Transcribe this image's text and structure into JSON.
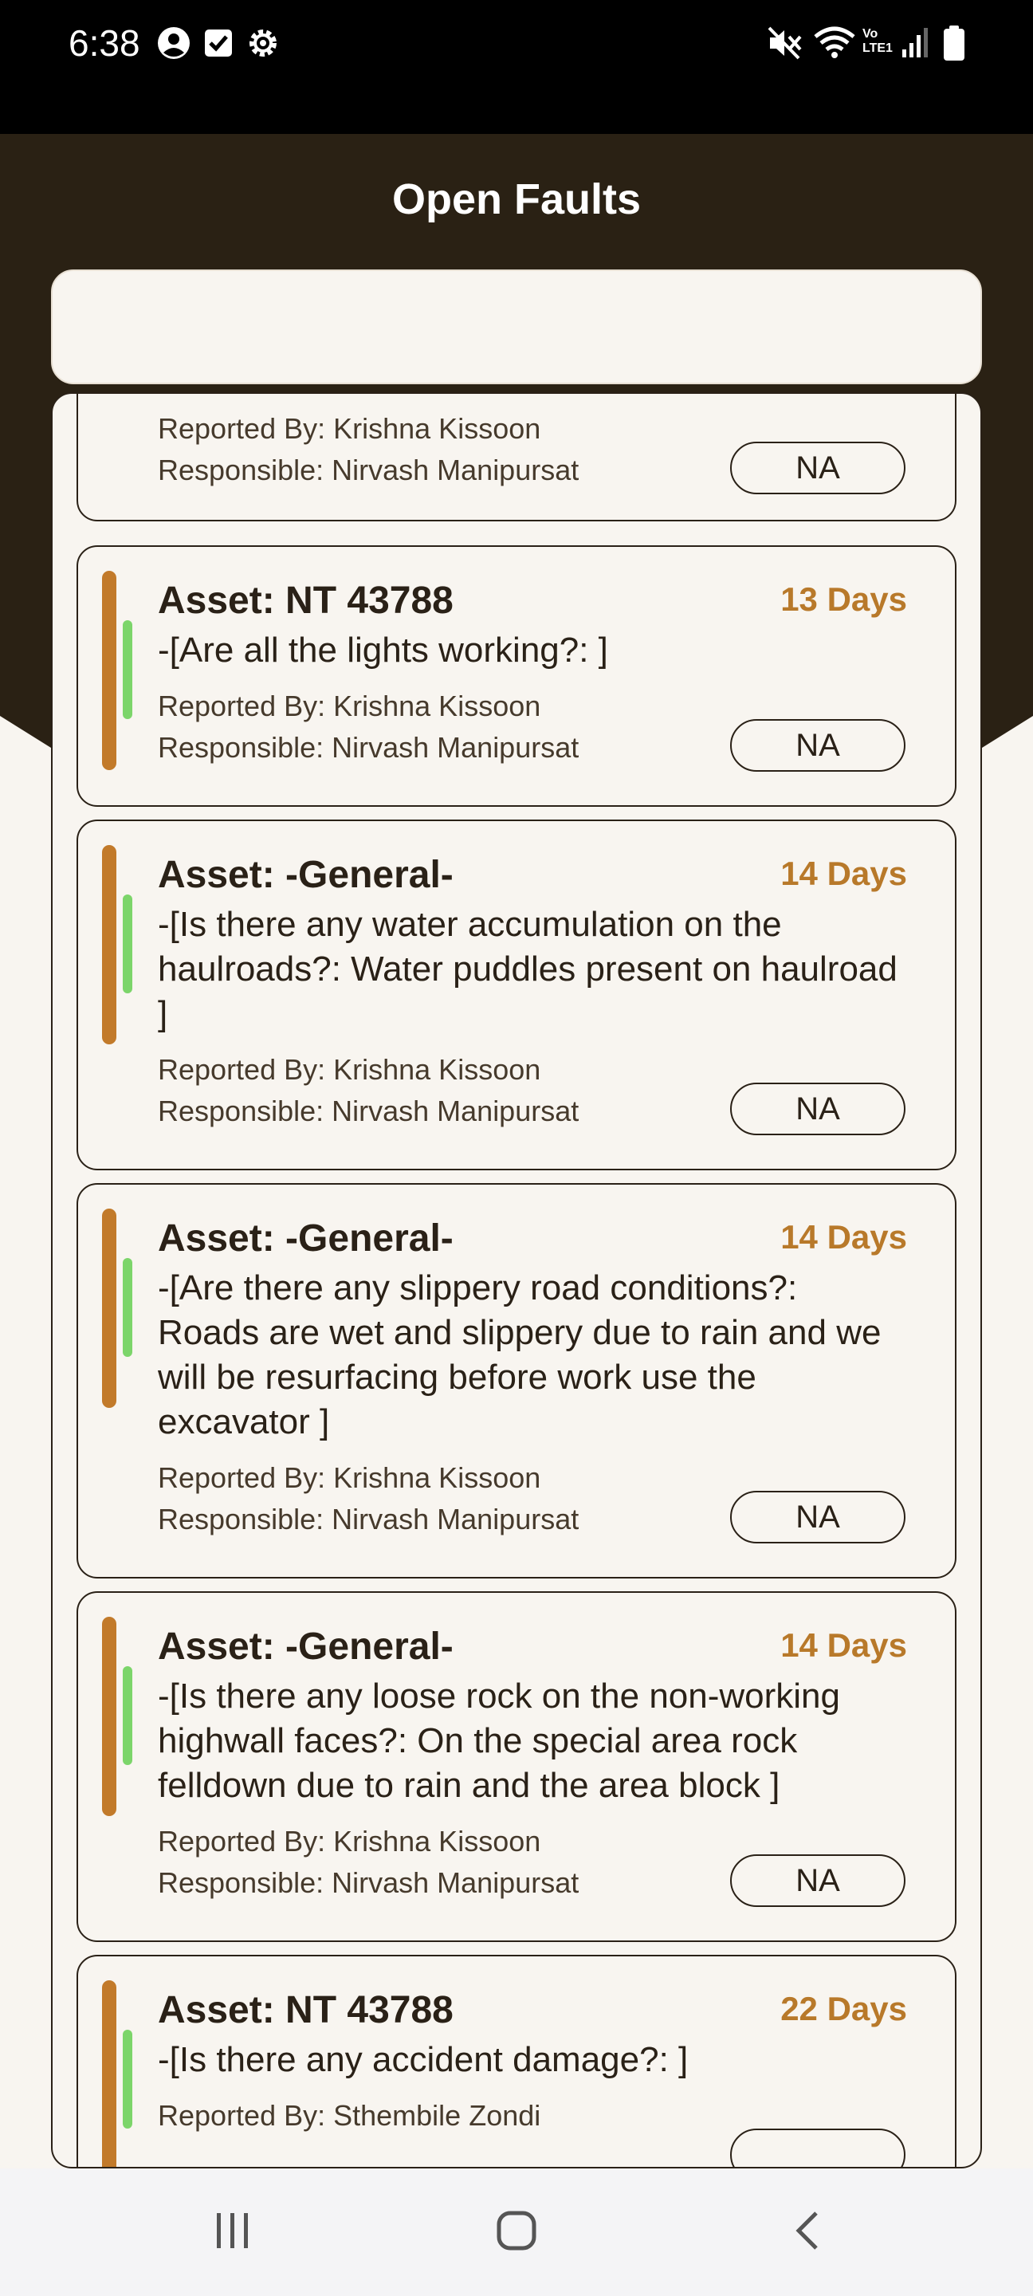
{
  "status_bar": {
    "time": "6:38",
    "icons": [
      "account-icon",
      "checkbox-icon",
      "settings-icon",
      "mute-icon",
      "wifi-icon",
      "volte-icon",
      "signal-icon",
      "battery-icon"
    ],
    "volte_label_top": "Vo",
    "volte_label_bottom": "LTE1"
  },
  "header": {
    "title": "Open Faults",
    "background_color": "#2a2114"
  },
  "search": {
    "placeholder": ""
  },
  "faults": [
    {
      "asset": "",
      "question": "",
      "reported_by": "Reported By: Krishna Kissoon",
      "responsible": "Responsible: Nirvash Manipursat",
      "days": "",
      "action": "NA"
    },
    {
      "asset": "Asset: NT 43788",
      "question": "-[Are all the lights working?: ]",
      "reported_by": "Reported By: Krishna Kissoon",
      "responsible": "Responsible: Nirvash Manipursat",
      "days": "13 Days",
      "action": "NA"
    },
    {
      "asset": "Asset: -General-",
      "question": "-[Is there any water accumulation on the haulroads?: Water puddles present on haulroad ]",
      "reported_by": "Reported By: Krishna Kissoon",
      "responsible": "Responsible: Nirvash Manipursat",
      "days": "14 Days",
      "action": "NA"
    },
    {
      "asset": "Asset: -General-",
      "question": "-[Are there any slippery road conditions?: Roads are wet and slippery due to rain and we will be resurfacing before work use the excavator ]",
      "reported_by": "Reported By: Krishna Kissoon",
      "responsible": "Responsible: Nirvash Manipursat",
      "days": "14 Days",
      "action": "NA"
    },
    {
      "asset": "Asset: -General-",
      "question": "-[Is there any loose rock on the non-working highwall faces?: On the special area rock felldown due to rain and the area block ]",
      "reported_by": "Reported By: Krishna Kissoon",
      "responsible": "Responsible: Nirvash Manipursat",
      "days": "14 Days",
      "action": "NA"
    },
    {
      "asset": "Asset: NT 43788",
      "question": "-[Is there any accident damage?: ]",
      "reported_by": "Reported By: Sthembile Zondi",
      "responsible": "",
      "days": "22 Days",
      "action": ""
    }
  ],
  "colors": {
    "accent_brown": "#c27a2a",
    "days_text": "#b8792a",
    "status_green": "#7cd56a"
  },
  "nav_bar": {
    "icons": [
      "recent-apps-icon",
      "home-icon",
      "back-icon"
    ]
  }
}
